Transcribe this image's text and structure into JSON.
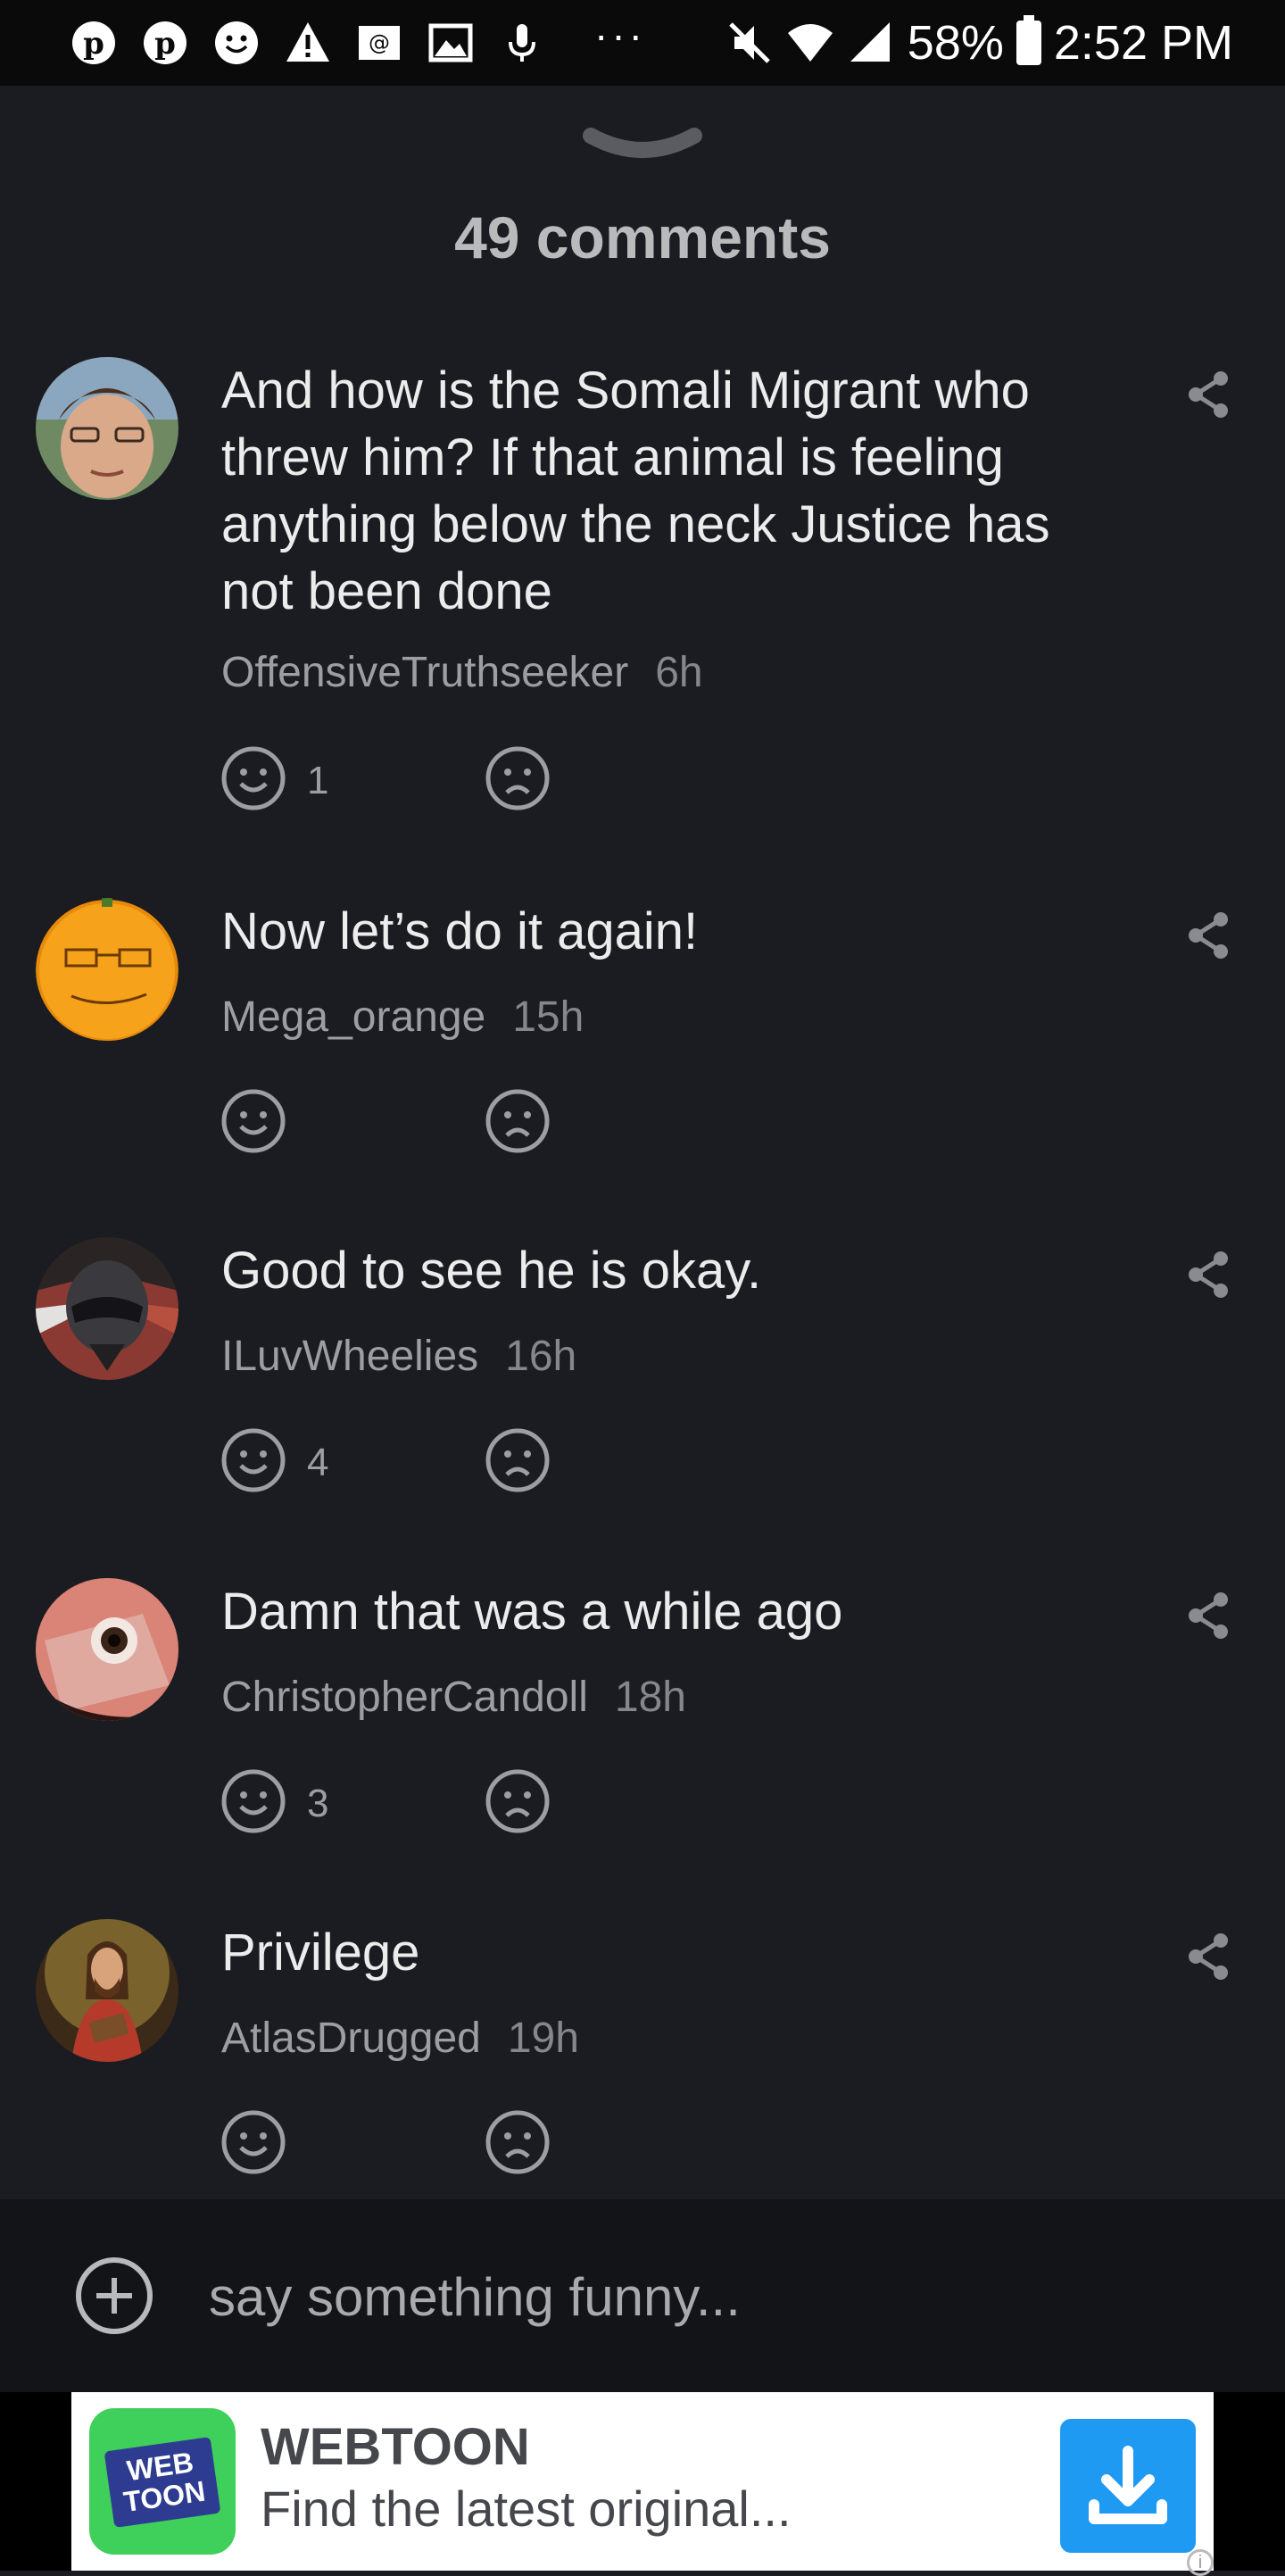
{
  "status_bar": {
    "battery": "58%",
    "time": "2:52 PM",
    "left_icons": [
      "pinterest-icon",
      "pinterest-icon",
      "smiley-icon",
      "warning-icon",
      "email-icon",
      "image-icon",
      "microphone-icon",
      "more-dots-icon"
    ],
    "overflow": "···",
    "right_icons": [
      "mute-icon",
      "wifi-icon",
      "signal-icon",
      "battery-icon"
    ]
  },
  "sheet": {
    "title": "49 comments"
  },
  "comments": [
    {
      "text": "And how is the Somali Migrant who threw him? If that animal is feeling anything below the neck Justice has not been done",
      "author": "OffensiveTruthseeker",
      "time": "6h",
      "likes": "1"
    },
    {
      "text": "Now let’s do it again!",
      "author": "Mega_orange",
      "time": "15h",
      "likes": ""
    },
    {
      "text": "Good to see he is okay.",
      "author": "ILuvWheelies",
      "time": "16h",
      "likes": "4"
    },
    {
      "text": "Damn that was a while ago",
      "author": "ChristopherCandoll",
      "time": "18h",
      "likes": "3"
    },
    {
      "text": "Privilege",
      "author": "AtlasDrugged",
      "time": "19h",
      "likes": ""
    }
  ],
  "composer": {
    "placeholder": "say something funny..."
  },
  "ad": {
    "logo_text": "WEB TOON",
    "title": "WEBTOON",
    "subtitle": "Find the latest original...",
    "info": "i"
  },
  "colors": {
    "background": "#1b1c21",
    "status_bar": "#0a0a0b",
    "composer": "#131418",
    "ad_button": "#1e9af2",
    "webtoon_green": "#3fcf5b"
  }
}
